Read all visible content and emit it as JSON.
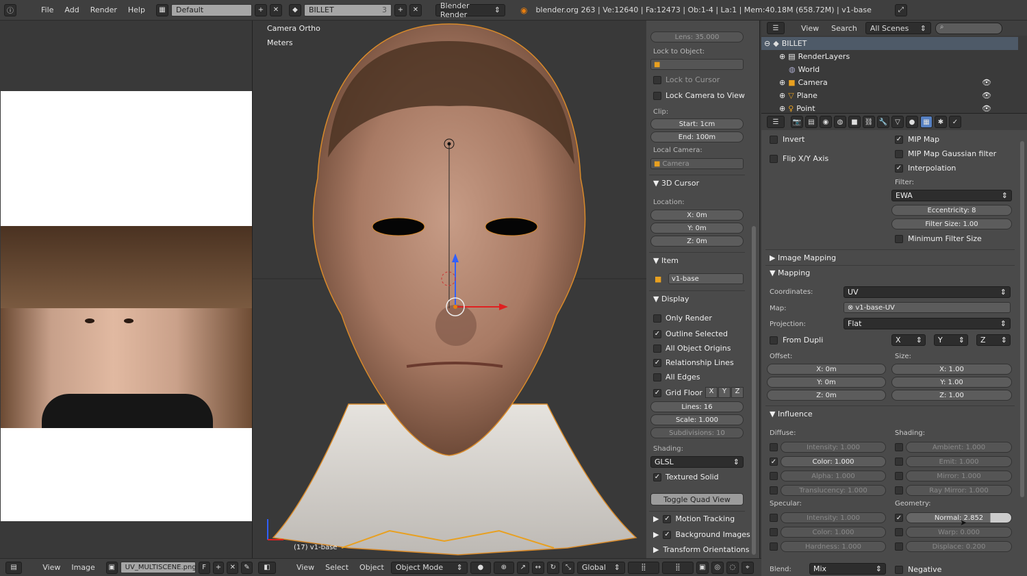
{
  "topbar": {
    "menus": [
      "File",
      "Add",
      "Render",
      "Help"
    ],
    "layout": "Default",
    "scene": "BILLET",
    "scene_count": "3",
    "engine": "Blender Render",
    "stats": "blender.org 263 | Ve:12640 | Fa:12473 | Ob:1-4 | La:1 | Mem:40.18M (658.72M) | v1-base"
  },
  "uv_editor": {
    "bottom_menus": [
      "View",
      "Image"
    ],
    "image_name": "UV_MULTISCENE.png",
    "fake_user": "F"
  },
  "viewport": {
    "camera_label": "Camera Ortho",
    "units_label": "Meters",
    "object_label": "(17) v1-base",
    "bottom_menus": [
      "View",
      "Select",
      "Object"
    ],
    "mode": "Object Mode",
    "orientation": "Global"
  },
  "npanel": {
    "lens": "Lens: 35.000",
    "lock_to_object": "Lock to Object:",
    "lock_to_cursor": "Lock to Cursor",
    "lock_camera_to_view": "Lock Camera to View",
    "clip": "Clip:",
    "clip_start": "Start: 1cm",
    "clip_end": "End: 100m",
    "local_camera": "Local Camera:",
    "camera": "Camera",
    "cursor_header": "3D Cursor",
    "location": "Location:",
    "cursor_x": "X: 0m",
    "cursor_y": "Y: 0m",
    "cursor_z": "Z: 0m",
    "item_header": "Item",
    "item_name": "v1-base",
    "display_header": "Display",
    "only_render": "Only Render",
    "outline_selected": "Outline Selected",
    "all_object_origins": "All Object Origins",
    "relationship_lines": "Relationship Lines",
    "all_edges": "All Edges",
    "grid_floor": "Grid Floor",
    "axes": [
      "X",
      "Y",
      "Z"
    ],
    "lines": "Lines: 16",
    "scale": "Scale: 1.000",
    "subdivisions": "Subdivisions: 10",
    "shading": "Shading:",
    "shading_value": "GLSL",
    "textured_solid": "Textured Solid",
    "toggle_quad": "Toggle Quad View",
    "motion_tracking": "Motion Tracking",
    "background_images": "Background Images",
    "transform_orientations": "Transform Orientations"
  },
  "outliner": {
    "menus": [
      "View",
      "Search"
    ],
    "scene_filter": "All Scenes",
    "items": [
      {
        "label": "BILLET"
      },
      {
        "label": "RenderLayers"
      },
      {
        "label": "World"
      },
      {
        "label": "Camera"
      },
      {
        "label": "Plane"
      },
      {
        "label": "Point"
      }
    ]
  },
  "properties": {
    "invert": "Invert",
    "flip_xy": "Flip X/Y Axis",
    "mip_map": "MIP Map",
    "mip_gauss": "MIP Map Gaussian filter",
    "interpolation": "Interpolation",
    "filter": "Filter:",
    "filter_value": "EWA",
    "eccentricity": "Eccentricity: 8",
    "filter_size": "Filter Size: 1.00",
    "min_filter_size": "Minimum Filter Size",
    "image_mapping": "Image Mapping",
    "mapping": "Mapping",
    "coordinates": "Coordinates:",
    "coordinates_value": "UV",
    "map": "Map:",
    "map_value": "v1-base-UV",
    "projection": "Projection:",
    "projection_value": "Flat",
    "from_dupli": "From Dupli",
    "axis_x": "X",
    "axis_y": "Y",
    "axis_z": "Z",
    "offset": "Offset:",
    "size": "Size:",
    "offset_x": "X: 0m",
    "offset_y": "Y: 0m",
    "offset_z": "Z: 0m",
    "size_x": "X: 1.00",
    "size_y": "Y: 1.00",
    "size_z": "Z: 1.00",
    "influence": "Influence",
    "diffuse": "Diffuse:",
    "shading": "Shading:",
    "d_intensity": "Intensity: 1.000",
    "d_color": "Color: 1.000",
    "d_alpha": "Alpha: 1.000",
    "d_translucency": "Translucency: 1.000",
    "s_ambient": "Ambient: 1.000",
    "s_emit": "Emit: 1.000",
    "s_mirror": "Mirror: 1.000",
    "s_raymirror": "Ray Mirror: 1.000",
    "specular": "Specular:",
    "geometry": "Geometry:",
    "sp_intensity": "Intensity: 1.000",
    "sp_color": "Color: 1.000",
    "sp_hardness": "Hardness: 1.000",
    "g_normal": "Normal: 2.852",
    "g_warp": "Warp: 0.000",
    "g_displace": "Displace: 0.200",
    "blend": "Blend:",
    "blend_value": "Mix",
    "negative": "Negative"
  }
}
